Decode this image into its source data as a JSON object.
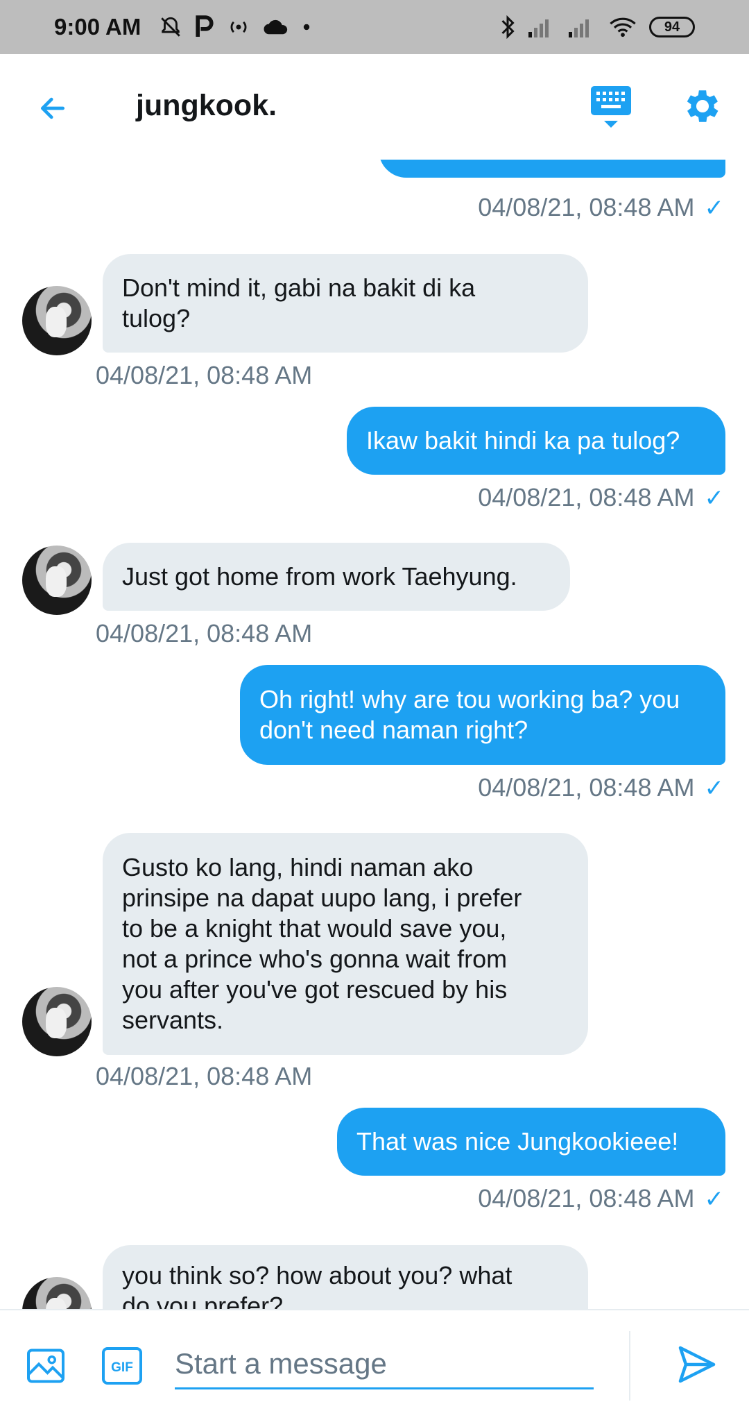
{
  "status_bar": {
    "time": "9:00 AM",
    "battery": "94",
    "icons": [
      "alarm-off-icon",
      "parking-icon",
      "hotspot-icon",
      "cloud-icon",
      "dot-icon",
      "bluetooth-icon",
      "signal-icon",
      "signal-icon",
      "wifi-icon",
      "battery-icon"
    ]
  },
  "header": {
    "contact_name": "jungkook.",
    "icons": [
      "back-arrow-icon",
      "keyboard-icon",
      "gear-icon"
    ]
  },
  "messages": [
    {
      "direction": "sent",
      "text": "",
      "timestamp": "04/08/21, 08:48 AM",
      "read": "✓"
    },
    {
      "direction": "received",
      "text": "Don't mind it, gabi na bakit di ka\ntulog?",
      "timestamp": "04/08/21, 08:48 AM"
    },
    {
      "direction": "sent",
      "text": "Ikaw bakit hindi ka pa tulog?",
      "timestamp": "04/08/21, 08:48 AM",
      "read": "✓"
    },
    {
      "direction": "received",
      "text": "Just got home from work Taehyung.",
      "timestamp": "04/08/21, 08:48 AM"
    },
    {
      "direction": "sent",
      "text": "Oh right! why are tou working ba? you\ndon't need naman right?",
      "timestamp": "04/08/21, 08:48 AM",
      "read": "✓"
    },
    {
      "direction": "received",
      "text": "Gusto ko lang, hindi naman ako\nprinsipe na dapat uupo lang, i prefer\nto be a knight that would save you,\nnot a prince who's gonna wait from\nyou after you've got rescued by his\nservants.",
      "timestamp": "04/08/21, 08:48 AM"
    },
    {
      "direction": "sent",
      "text": "That was nice Jungkookieee!",
      "timestamp": "04/08/21, 08:48 AM",
      "read": "✓"
    },
    {
      "direction": "received",
      "text": "you think so? how about you? what\ndo you prefer?",
      "timestamp": ""
    }
  ],
  "composer": {
    "placeholder": "Start a message",
    "value": "",
    "gif_label": "GIF",
    "icons": [
      "image-icon",
      "gif-icon",
      "send-icon"
    ]
  },
  "colors": {
    "accent": "#1da1f2",
    "received_bubble": "#e6ecf0",
    "timestamp_text": "#657786",
    "status_bar": "#bdbdbd"
  }
}
